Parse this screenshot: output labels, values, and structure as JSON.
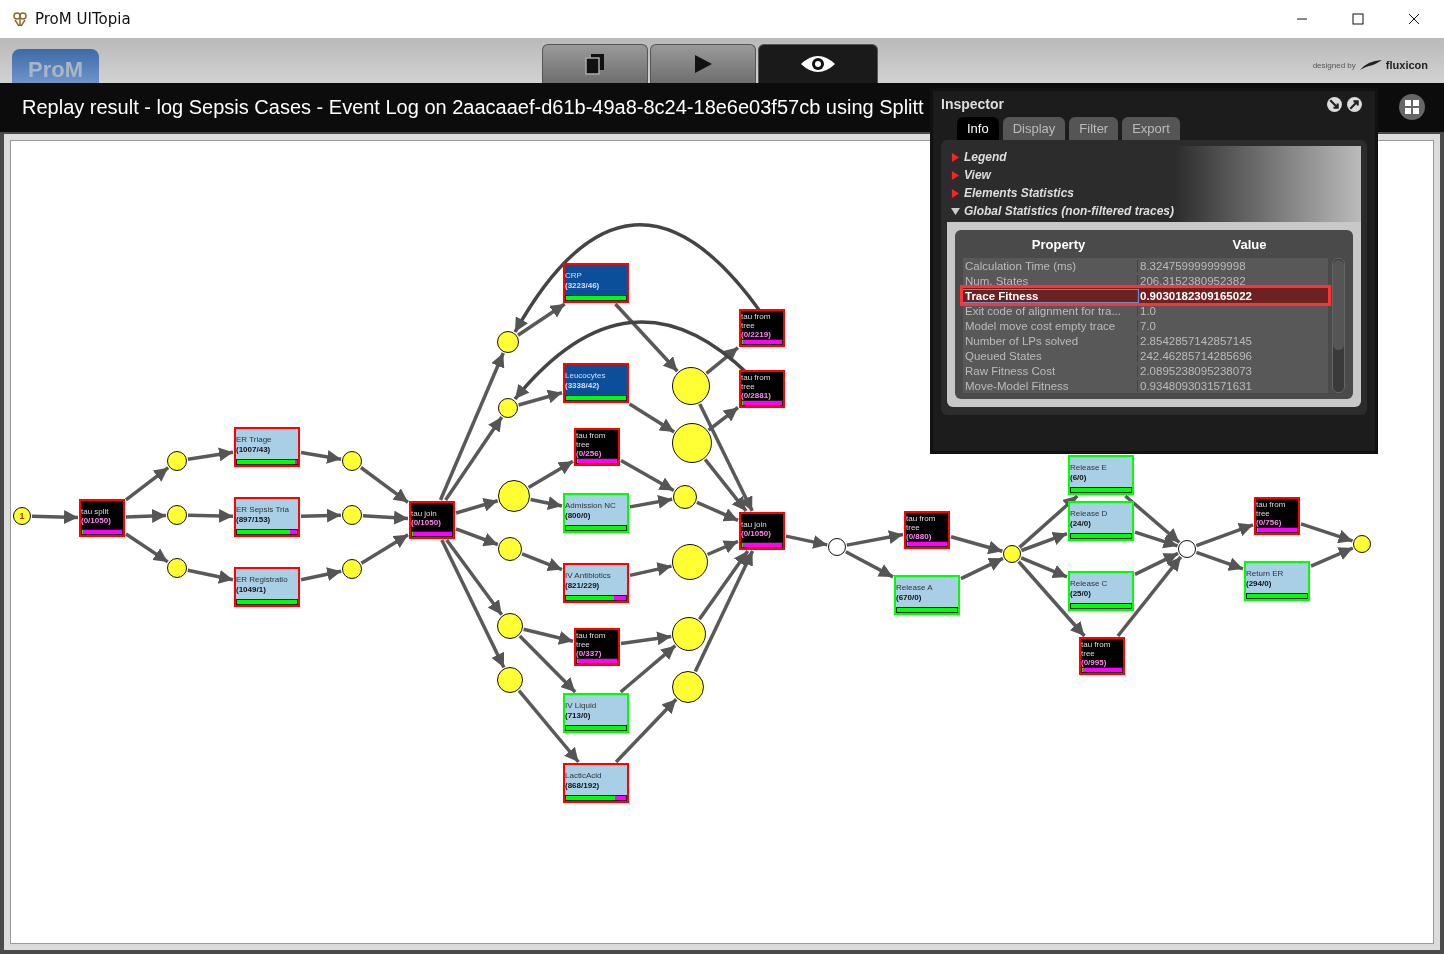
{
  "window": {
    "title": "ProM UITopia"
  },
  "brand": {
    "logo": "ProM",
    "designed_by": "designed by",
    "maker": "fluxicon"
  },
  "view_tabs": [
    {
      "kind": "workspace",
      "selected": false
    },
    {
      "kind": "actions",
      "selected": false
    },
    {
      "kind": "views",
      "selected": true
    }
  ],
  "view_title": "Replay result - log Sepsis Cases - Event Log on 2aacaaef-d61b-49a8-8c24-18e6e03f57cb using Splitt",
  "places": [
    {
      "color": "#ffff33",
      "token": "1"
    },
    {
      "color": "#ffff33"
    },
    {
      "color": "#ffff33"
    },
    {
      "color": "#ffff33"
    },
    {
      "color": "#ffff33"
    },
    {
      "color": "#ffff33"
    },
    {
      "color": "#ffff33"
    },
    {
      "color": "#ffff33"
    },
    {
      "color": "#ffff33"
    },
    {
      "color": "#ffff33"
    },
    {
      "color": "#ffff33"
    },
    {
      "color": "#ffff33"
    },
    {
      "color": "#ffff33"
    },
    {
      "color": "#ffff33"
    },
    {
      "color": "#ffff33"
    },
    {
      "color": "#ffff33"
    },
    {
      "color": "#ffff33"
    },
    {
      "color": "#ffff33"
    },
    {
      "color": "#ffff33"
    },
    {
      "color": "#ffffff"
    },
    {
      "color": "#ffff33"
    },
    {
      "color": "#ffffff"
    },
    {
      "color": "#ffff33"
    }
  ],
  "transitions": [
    {
      "label": "tau split",
      "count": "(0/1050)",
      "kind": "tau",
      "deviating": true,
      "level": 0
    },
    {
      "label": "ER Triage",
      "count": "(1007/43)",
      "kind": "activity",
      "deviating": true,
      "level": 0.96
    },
    {
      "label": "ER Sepsis Tria",
      "count": "(897/153)",
      "kind": "activity",
      "deviating": true,
      "level": 0.88
    },
    {
      "label": "ER Registratio",
      "count": "(1049/1)",
      "kind": "activity",
      "deviating": true,
      "level": 1
    },
    {
      "label": "tau join",
      "count": "(0/1050)",
      "kind": "tau",
      "deviating": true,
      "level": 0
    },
    {
      "label": "CRP",
      "count": "(3223/46)",
      "kind": "frequent",
      "deviating": true,
      "level": 1
    },
    {
      "label": "Leucocytes",
      "count": "(3338/42)",
      "kind": "frequent",
      "deviating": true,
      "level": 1
    },
    {
      "label": "tau from tree",
      "count": "(0/256)",
      "kind": "tau",
      "deviating": true,
      "level": 0
    },
    {
      "label": "Admission NC",
      "count": "(800/0)",
      "kind": "activity",
      "deviating": false,
      "level": 1
    },
    {
      "label": "IV Antibiotics",
      "count": "(821/229)",
      "kind": "activity",
      "deviating": true,
      "level": 0.8
    },
    {
      "label": "tau from tree",
      "count": "(0/337)",
      "kind": "tau",
      "deviating": true,
      "level": 0
    },
    {
      "label": "IV Liquid",
      "count": "(713/0)",
      "kind": "activity",
      "deviating": false,
      "level": 1
    },
    {
      "label": "LacticAcid",
      "count": "(868/192)",
      "kind": "activity",
      "deviating": true,
      "level": 0.82
    },
    {
      "label": "tau from tree",
      "count": "(0/2219)",
      "kind": "tau",
      "deviating": true,
      "level": 0
    },
    {
      "label": "tau from tree",
      "count": "(0/2881)",
      "kind": "tau",
      "deviating": true,
      "level": 0
    },
    {
      "label": "tau join",
      "count": "(0/1050)",
      "kind": "tau",
      "deviating": true,
      "level": 0
    },
    {
      "label": "tau from tree",
      "count": "(0/880)",
      "kind": "tau",
      "deviating": true,
      "level": 0
    },
    {
      "label": "Release A",
      "count": "(670/0)",
      "kind": "activity",
      "deviating": false,
      "level": 1
    },
    {
      "label": "Release E",
      "count": "(6/0)",
      "kind": "activity",
      "deviating": false,
      "level": 1
    },
    {
      "label": "Release D",
      "count": "(24/0)",
      "kind": "activity",
      "deviating": false,
      "level": 1
    },
    {
      "label": "Release C",
      "count": "(25/0)",
      "kind": "activity",
      "deviating": false,
      "level": 1
    },
    {
      "label": "tau from tree",
      "count": "(0/995)",
      "kind": "tau",
      "deviating": true,
      "level": 0
    },
    {
      "label": "tau from tree",
      "count": "(0/756)",
      "kind": "tau",
      "deviating": true,
      "level": 0
    },
    {
      "label": "Return ER",
      "count": "(294/0)",
      "kind": "activity",
      "deviating": false,
      "level": 1
    }
  ],
  "inspector": {
    "title": "Inspector",
    "tabs": [
      {
        "label": "Info",
        "selected": true
      },
      {
        "label": "Display",
        "selected": false
      },
      {
        "label": "Filter",
        "selected": false
      },
      {
        "label": "Export",
        "selected": false
      }
    ],
    "sections": [
      {
        "label": "Legend",
        "expanded": false
      },
      {
        "label": "View",
        "expanded": false
      },
      {
        "label": "Elements Statistics",
        "expanded": false
      },
      {
        "label": "Global Statistics (non-filtered traces)",
        "expanded": true
      }
    ],
    "table": {
      "columns": [
        "Property",
        "Value"
      ],
      "rows": [
        {
          "property": "Calculation Time (ms)",
          "value": "8.324759999999998",
          "selected": false
        },
        {
          "property": "Num. States",
          "value": "206.3152380952382",
          "selected": false
        },
        {
          "property": "Trace Fitness",
          "value": "0.9030182309165022",
          "selected": true
        },
        {
          "property": "Exit code of alignment for tra...",
          "value": "1.0",
          "selected": false
        },
        {
          "property": "Model move cost empty trace",
          "value": "7.0",
          "selected": false
        },
        {
          "property": "Number of LPs solved",
          "value": "2.8542857142857145",
          "selected": false
        },
        {
          "property": "Queued States",
          "value": "242.46285714285696",
          "selected": false
        },
        {
          "property": "Raw Fitness Cost",
          "value": "2.0895238095238073",
          "selected": false
        },
        {
          "property": "Move-Model Fitness",
          "value": "0.9348093031571631",
          "selected": false
        }
      ]
    }
  }
}
